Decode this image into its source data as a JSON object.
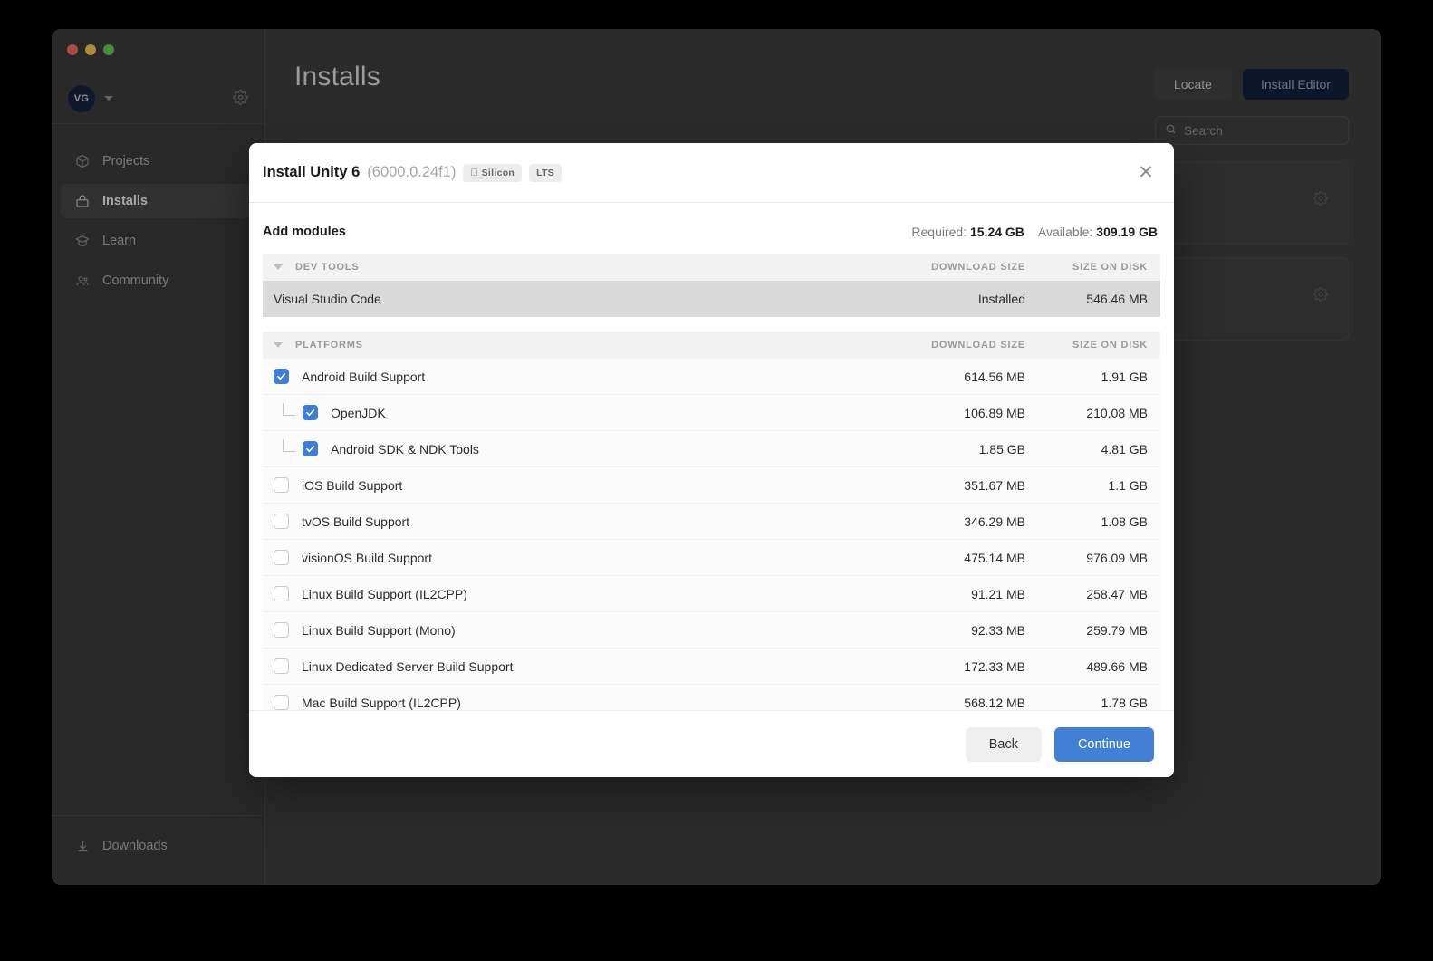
{
  "window": {
    "traffic_lights": [
      "close",
      "minimize",
      "maximize"
    ]
  },
  "sidebar": {
    "account": {
      "initials": "VG"
    },
    "items": [
      {
        "label": "Projects",
        "icon": "cube-icon",
        "active": false
      },
      {
        "label": "Installs",
        "icon": "install-icon",
        "active": true
      },
      {
        "label": "Learn",
        "icon": "graduation-icon",
        "active": false
      },
      {
        "label": "Community",
        "icon": "people-icon",
        "active": false
      }
    ],
    "footer": {
      "label": "Downloads",
      "icon": "download-icon"
    }
  },
  "header": {
    "title": "Installs",
    "locate_label": "Locate",
    "install_editor_label": "Install Editor"
  },
  "search": {
    "placeholder": "Search",
    "value": ""
  },
  "modal": {
    "title": "Install Unity 6",
    "version": "(6000.0.24f1)",
    "chips": [
      {
        "label": "Silicon",
        "icon": "apple-icon"
      },
      {
        "label": "LTS",
        "icon": ""
      }
    ],
    "close_label": "✕",
    "section_label": "Add modules",
    "required_label": "Required:",
    "required_value": "15.24 GB",
    "available_label": "Available:",
    "available_value": "309.19 GB",
    "columns": {
      "download": "DOWNLOAD SIZE",
      "disk": "SIZE ON DISK"
    },
    "sections": [
      {
        "name": "DEV TOOLS",
        "expanded": true,
        "rows": [
          {
            "label": "Visual Studio Code",
            "download": "Installed",
            "disk": "546.46 MB",
            "state": "installed",
            "indent": 0
          }
        ]
      },
      {
        "name": "PLATFORMS",
        "expanded": true,
        "rows": [
          {
            "label": "Android Build Support",
            "download": "614.56 MB",
            "disk": "1.91 GB",
            "state": "checked",
            "indent": 0
          },
          {
            "label": "OpenJDK",
            "download": "106.89 MB",
            "disk": "210.08 MB",
            "state": "checked",
            "indent": 1
          },
          {
            "label": "Android SDK & NDK Tools",
            "download": "1.85 GB",
            "disk": "4.81 GB",
            "state": "checked",
            "indent": 1
          },
          {
            "label": "iOS Build Support",
            "download": "351.67 MB",
            "disk": "1.1 GB",
            "state": "unchecked",
            "indent": 0
          },
          {
            "label": "tvOS Build Support",
            "download": "346.29 MB",
            "disk": "1.08 GB",
            "state": "unchecked",
            "indent": 0
          },
          {
            "label": "visionOS Build Support",
            "download": "475.14 MB",
            "disk": "976.09 MB",
            "state": "unchecked",
            "indent": 0
          },
          {
            "label": "Linux Build Support (IL2CPP)",
            "download": "91.21 MB",
            "disk": "258.47 MB",
            "state": "unchecked",
            "indent": 0
          },
          {
            "label": "Linux Build Support (Mono)",
            "download": "92.33 MB",
            "disk": "259.79 MB",
            "state": "unchecked",
            "indent": 0
          },
          {
            "label": "Linux Dedicated Server Build Support",
            "download": "172.33 MB",
            "disk": "489.66 MB",
            "state": "unchecked",
            "indent": 0
          },
          {
            "label": "Mac Build Support (IL2CPP)",
            "download": "568.12 MB",
            "disk": "1.78 GB",
            "state": "unchecked",
            "indent": 0
          }
        ]
      }
    ],
    "back_label": "Back",
    "continue_label": "Continue"
  },
  "colors": {
    "accent_blue": "#4180d4",
    "checkbox_blue": "#3d7ed8",
    "window_bg": "#3c3c3c",
    "modal_bg": "#ffffff",
    "installed_row": "#d9d9d9"
  }
}
